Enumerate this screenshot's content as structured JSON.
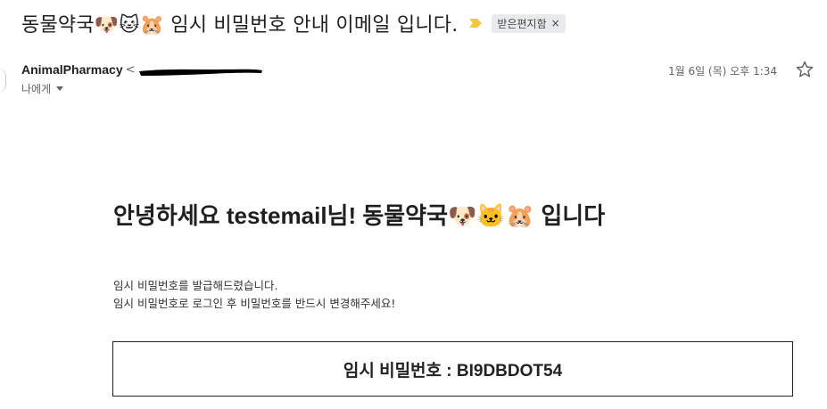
{
  "email": {
    "subject": "동물약국🐶🐱🐹 임시 비밀번호 안내 이메일 입니다.",
    "label_chip": "받은편지함",
    "label_chip_close": "×",
    "sender_name": "AnimalPharmacy",
    "sender_lt": "<",
    "recipient": "나에게",
    "date": "1월 6일 (목) 오후 1:34"
  },
  "body": {
    "greeting": "안녕하세요 testemail님! 동물약국🐶🐱🐹 입니다",
    "line1": "임시 비밀번호를 발급해드렸습니다.",
    "line2": "임시 비밀번호로 로그인 후 비밀번호를 반드시 변경해주세요!",
    "password_line": "임시 비밀번호 : BI9DBDOT54"
  },
  "icons": {
    "importance": "importance-marker-icon",
    "star": "star-icon",
    "caret": "caret-down-icon"
  },
  "colors": {
    "importance": "#f2c744",
    "chip_bg": "#e8eaed",
    "redaction": "#000000"
  }
}
